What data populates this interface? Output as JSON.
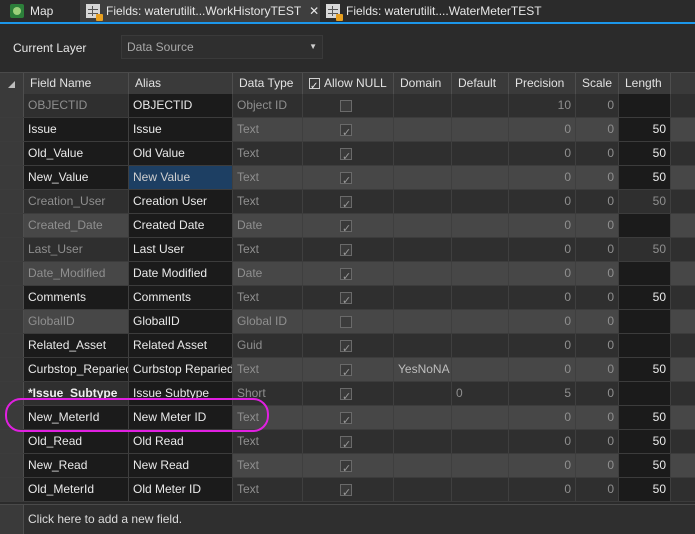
{
  "tabs": [
    {
      "label": "Map",
      "icon": "map-icon"
    },
    {
      "label": "Fields:  waterutilit...WorkHistoryTEST",
      "icon": "fields-table-icon",
      "close": "✕"
    },
    {
      "label": "Fields:  waterutilit....WaterMeterTEST",
      "icon": "fields-table-icon"
    }
  ],
  "layer": {
    "label": "Current Layer",
    "value": "Data Source"
  },
  "columns": [
    "Field Name",
    "Alias",
    "Data Type",
    "Allow NULL",
    "Domain",
    "Default",
    "Precision",
    "Scale",
    "Length"
  ],
  "rows": [
    {
      "name": "OBJECTID",
      "alias": "OBJECTID",
      "type": "Object ID",
      "allow_null": false,
      "domain": "",
      "default": "",
      "precision": "10",
      "scale": "0",
      "length": ""
    },
    {
      "name": "Issue",
      "alias": "Issue",
      "type": "Text",
      "allow_null": true,
      "domain": "",
      "default": "",
      "precision": "0",
      "scale": "0",
      "length": "50"
    },
    {
      "name": "Old_Value",
      "alias": "Old Value",
      "type": "Text",
      "allow_null": true,
      "domain": "",
      "default": "",
      "precision": "0",
      "scale": "0",
      "length": "50"
    },
    {
      "name": "New_Value",
      "alias": "New Value",
      "type": "Text",
      "allow_null": true,
      "domain": "",
      "default": "",
      "precision": "0",
      "scale": "0",
      "length": "50"
    },
    {
      "name": "Creation_User",
      "alias": "Creation User",
      "type": "Text",
      "allow_null": true,
      "domain": "",
      "default": "",
      "precision": "0",
      "scale": "0",
      "length": "50"
    },
    {
      "name": "Created_Date",
      "alias": "Created Date",
      "type": "Date",
      "allow_null": true,
      "domain": "",
      "default": "",
      "precision": "0",
      "scale": "0",
      "length": ""
    },
    {
      "name": "Last_User",
      "alias": "Last User",
      "type": "Text",
      "allow_null": true,
      "domain": "",
      "default": "",
      "precision": "0",
      "scale": "0",
      "length": "50"
    },
    {
      "name": "Date_Modified",
      "alias": "Date Modified",
      "type": "Date",
      "allow_null": true,
      "domain": "",
      "default": "",
      "precision": "0",
      "scale": "0",
      "length": ""
    },
    {
      "name": "Comments",
      "alias": "Comments",
      "type": "Text",
      "allow_null": true,
      "domain": "",
      "default": "",
      "precision": "0",
      "scale": "0",
      "length": "50"
    },
    {
      "name": "GlobalID",
      "alias": "GlobalID",
      "type": "Global ID",
      "allow_null": false,
      "domain": "",
      "default": "",
      "precision": "0",
      "scale": "0",
      "length": ""
    },
    {
      "name": "Related_Asset",
      "alias": "Related Asset",
      "type": "Guid",
      "allow_null": true,
      "domain": "",
      "default": "",
      "precision": "0",
      "scale": "0",
      "length": ""
    },
    {
      "name": "Curbstop_Reparied",
      "alias": "Curbstop Reparied",
      "type": "Text",
      "allow_null": true,
      "domain": "YesNoNA",
      "default": "",
      "precision": "0",
      "scale": "0",
      "length": "50"
    },
    {
      "name": "*Issue_Subtype",
      "alias": "Issue Subtype",
      "type": "Short",
      "allow_null": true,
      "domain": "",
      "default": "0",
      "precision": "5",
      "scale": "0",
      "length": ""
    },
    {
      "name": "New_MeterId",
      "alias": "New Meter ID",
      "type": "Text",
      "allow_null": true,
      "domain": "",
      "default": "",
      "precision": "0",
      "scale": "0",
      "length": "50"
    },
    {
      "name": "Old_Read",
      "alias": "Old Read",
      "type": "Text",
      "allow_null": true,
      "domain": "",
      "default": "",
      "precision": "0",
      "scale": "0",
      "length": "50"
    },
    {
      "name": "New_Read",
      "alias": "New Read",
      "type": "Text",
      "allow_null": true,
      "domain": "",
      "default": "",
      "precision": "0",
      "scale": "0",
      "length": "50"
    },
    {
      "name": "Old_MeterId",
      "alias": "Old Meter ID",
      "type": "Text",
      "allow_null": true,
      "domain": "",
      "default": "",
      "precision": "0",
      "scale": "0",
      "length": "50"
    }
  ],
  "footer": {
    "add_label": "Click here to add a new field."
  },
  "colors": {
    "accent": "#1c97ea",
    "highlight": "#e020e0"
  }
}
